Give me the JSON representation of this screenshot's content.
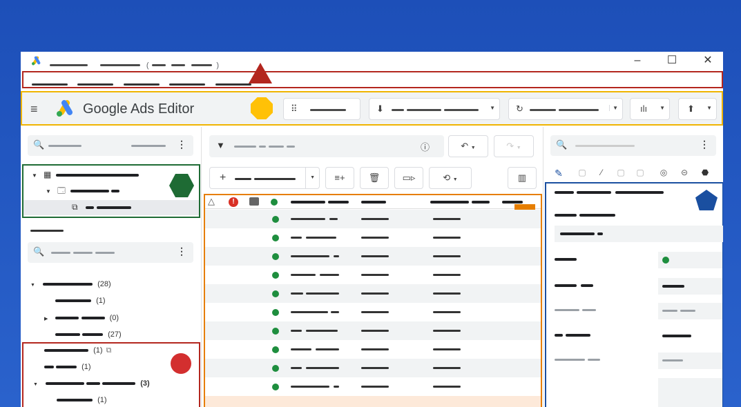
{
  "titlebar": {
    "paren_text": "(",
    "paren_close": ")",
    "minimize": "–",
    "maximize": "☐",
    "close": "✕"
  },
  "toolbar": {
    "app_name": "Google Ads Editor",
    "menu_icon": "hamburger-icon",
    "buttons": [
      "grid-view",
      "download",
      "refresh",
      "stats",
      "upload"
    ]
  },
  "left": {
    "tree_counts": [
      "(28)",
      "(1)",
      "(0)",
      "(27)",
      "(1)",
      "(1)",
      "(3)",
      "(1)"
    ]
  },
  "colors": {
    "menubar_outline": "#b3261e",
    "toolbar_outline": "#f0b400",
    "tree_outline": "#1e6b34",
    "grid_outline": "#e67e00",
    "editor_outline": "#1a4fa0",
    "status_enabled": "#1e8e3e",
    "background": "#1d4fb8"
  }
}
